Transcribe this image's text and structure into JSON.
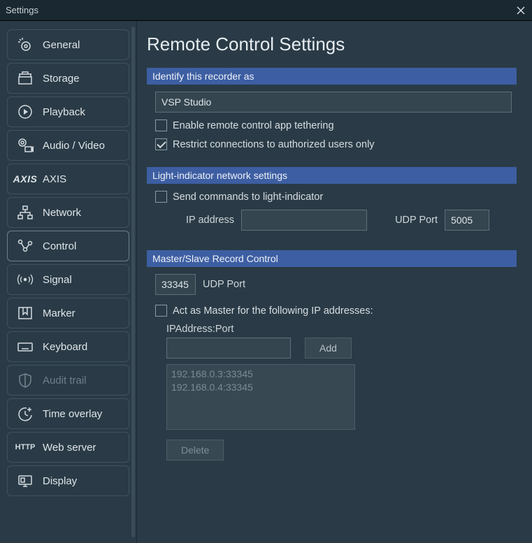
{
  "window": {
    "title": "Settings"
  },
  "sidebar": {
    "items": [
      {
        "label": "General"
      },
      {
        "label": "Storage"
      },
      {
        "label": "Playback"
      },
      {
        "label": "Audio / Video"
      },
      {
        "label": "AXIS"
      },
      {
        "label": "Network"
      },
      {
        "label": "Control"
      },
      {
        "label": "Signal"
      },
      {
        "label": "Marker"
      },
      {
        "label": "Keyboard"
      },
      {
        "label": "Audit trail"
      },
      {
        "label": "Time overlay"
      },
      {
        "label": "Web server"
      },
      {
        "label": "Display"
      }
    ]
  },
  "main": {
    "title": "Remote Control Settings",
    "section1": {
      "header": "Identify this recorder as",
      "recorder_name": "VSP Studio",
      "enable_tethering_label": "Enable remote control app tethering",
      "restrict_label": "Restrict connections to authorized users only"
    },
    "section2": {
      "header": "Light-indicator network settings",
      "send_cmd_label": "Send commands to light-indicator",
      "ip_label": "IP address",
      "ip_value": "",
      "udp_port_label": "UDP Port",
      "udp_port_value": "5005"
    },
    "section3": {
      "header": "Master/Slave Record Control",
      "udp_port_value": "33345",
      "udp_port_label": "UDP Port",
      "act_master_label": "Act as Master for the following IP addresses:",
      "ipaddr_label": "IPAddress:Port",
      "ipaddr_value": "",
      "add_btn": "Add",
      "list": [
        "192.168.0.3:33345",
        "192.168.0.4:33345"
      ],
      "delete_btn": "Delete"
    }
  }
}
